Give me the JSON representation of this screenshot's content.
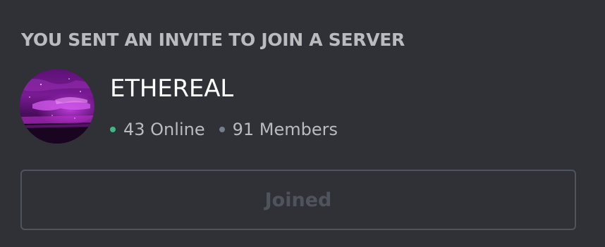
{
  "invite": {
    "header": "YOU SENT AN INVITE TO JOIN A SERVER",
    "server": {
      "name": "ETHEREAL",
      "icon": "server-avatar-purple-clouds",
      "online_text": "43 Online",
      "members_text": "91 Members",
      "online_count": 43,
      "member_count": 91
    },
    "button_label": "Joined"
  },
  "colors": {
    "background": "#2f3136",
    "header_text": "#b9bbbe",
    "name_text": "#ffffff",
    "online_dot": "#43b581",
    "members_dot": "#747f8d",
    "button_border": "#4f545c",
    "button_text": "#4f545c"
  }
}
